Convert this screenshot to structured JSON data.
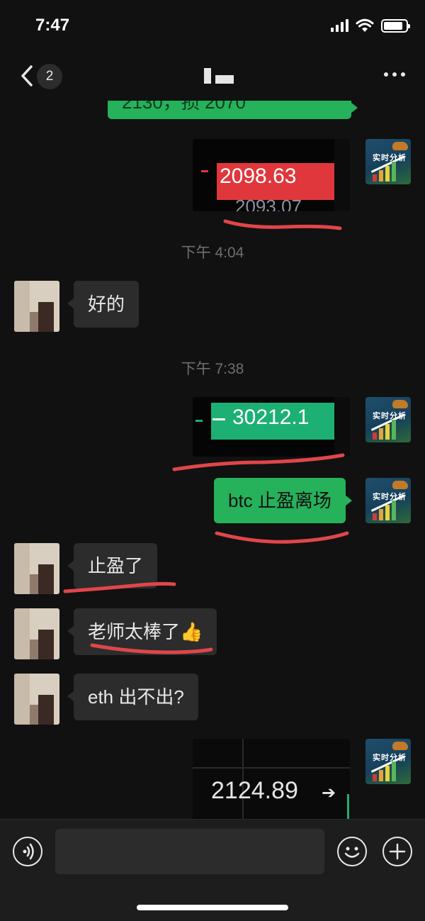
{
  "status_bar": {
    "time": "7:47",
    "battery_level": 0.85
  },
  "nav": {
    "unread_count": "2"
  },
  "colors": {
    "me_bubble": "#26b15b",
    "them_bubble": "#2c2c2c",
    "price_red": "#e0373c",
    "price_green": "#1db074",
    "underline": "#e0464a"
  },
  "messages": {
    "top_partial_text": "2130，损 2070",
    "img1_price": "2098.63",
    "img1_sub": "2093.07",
    "img1_dash": "–",
    "time1": "下午 4:04",
    "them1": "好的",
    "time2": "下午 7:38",
    "img2_price": "30212.1",
    "img2_dash": "–",
    "me1": "btc 止盈离场",
    "them2": "止盈了",
    "them3": "老师太棒了👍",
    "them4": "eth 出不出?",
    "img3_price": "2124.89",
    "img3_arrow": "➔"
  },
  "avatar": {
    "me_text": "实时分析",
    "me_icon": "bull-chart-avatar",
    "them_icon": "pixelated-avatar"
  },
  "input": {
    "placeholder": ""
  }
}
